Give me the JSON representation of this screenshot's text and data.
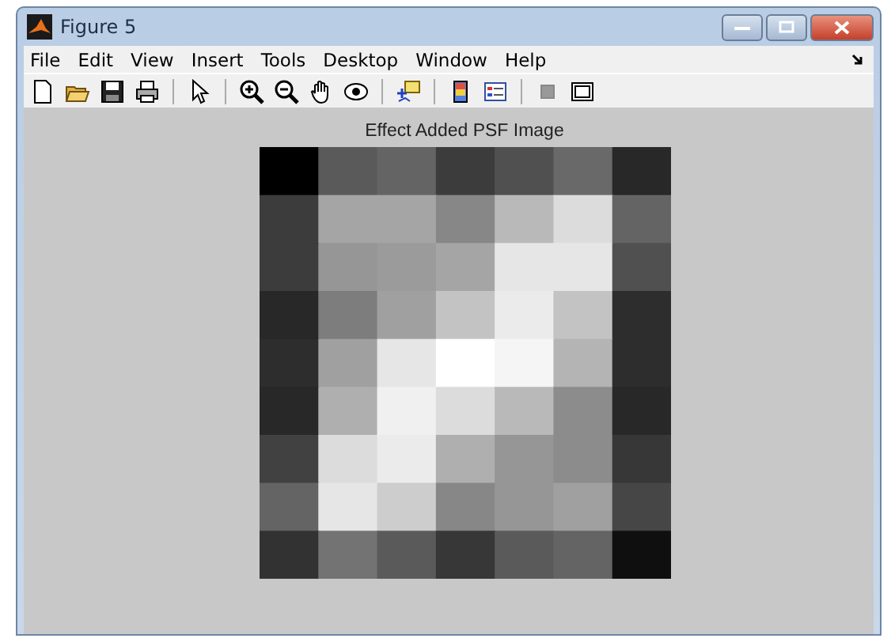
{
  "window": {
    "title": "Figure 5"
  },
  "menu": [
    "File",
    "Edit",
    "View",
    "Insert",
    "Tools",
    "Desktop",
    "Window",
    "Help"
  ],
  "toolbar": [
    {
      "kind": "new"
    },
    {
      "kind": "open"
    },
    {
      "kind": "save"
    },
    {
      "kind": "print"
    },
    {
      "kind": "sep"
    },
    {
      "kind": "pointer"
    },
    {
      "kind": "sep"
    },
    {
      "kind": "zoomin"
    },
    {
      "kind": "zoomout"
    },
    {
      "kind": "pan"
    },
    {
      "kind": "rotate"
    },
    {
      "kind": "sep"
    },
    {
      "kind": "cursor"
    },
    {
      "kind": "sep"
    },
    {
      "kind": "colorbar"
    },
    {
      "kind": "legend"
    },
    {
      "kind": "sep"
    },
    {
      "kind": "hide"
    },
    {
      "kind": "show"
    }
  ],
  "axes": {
    "title": "Effect Added PSF Image"
  }
}
